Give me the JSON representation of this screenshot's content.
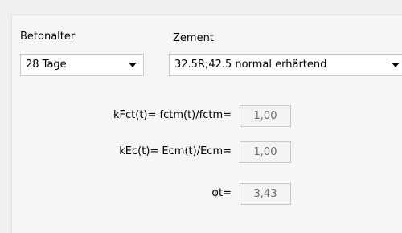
{
  "betonalter": {
    "label": "Betonalter",
    "value": "28 Tage"
  },
  "zement": {
    "label": "Zement",
    "value": "32.5R;42.5  normal erhärtend"
  },
  "rows": [
    {
      "label": "kFct(t)= fctm(t)/fctm=",
      "value": "1,00"
    },
    {
      "label": "kEc(t)= Ecm(t)/Ecm=",
      "value": "1,00"
    },
    {
      "label": "φt=",
      "value": "3,43"
    }
  ]
}
